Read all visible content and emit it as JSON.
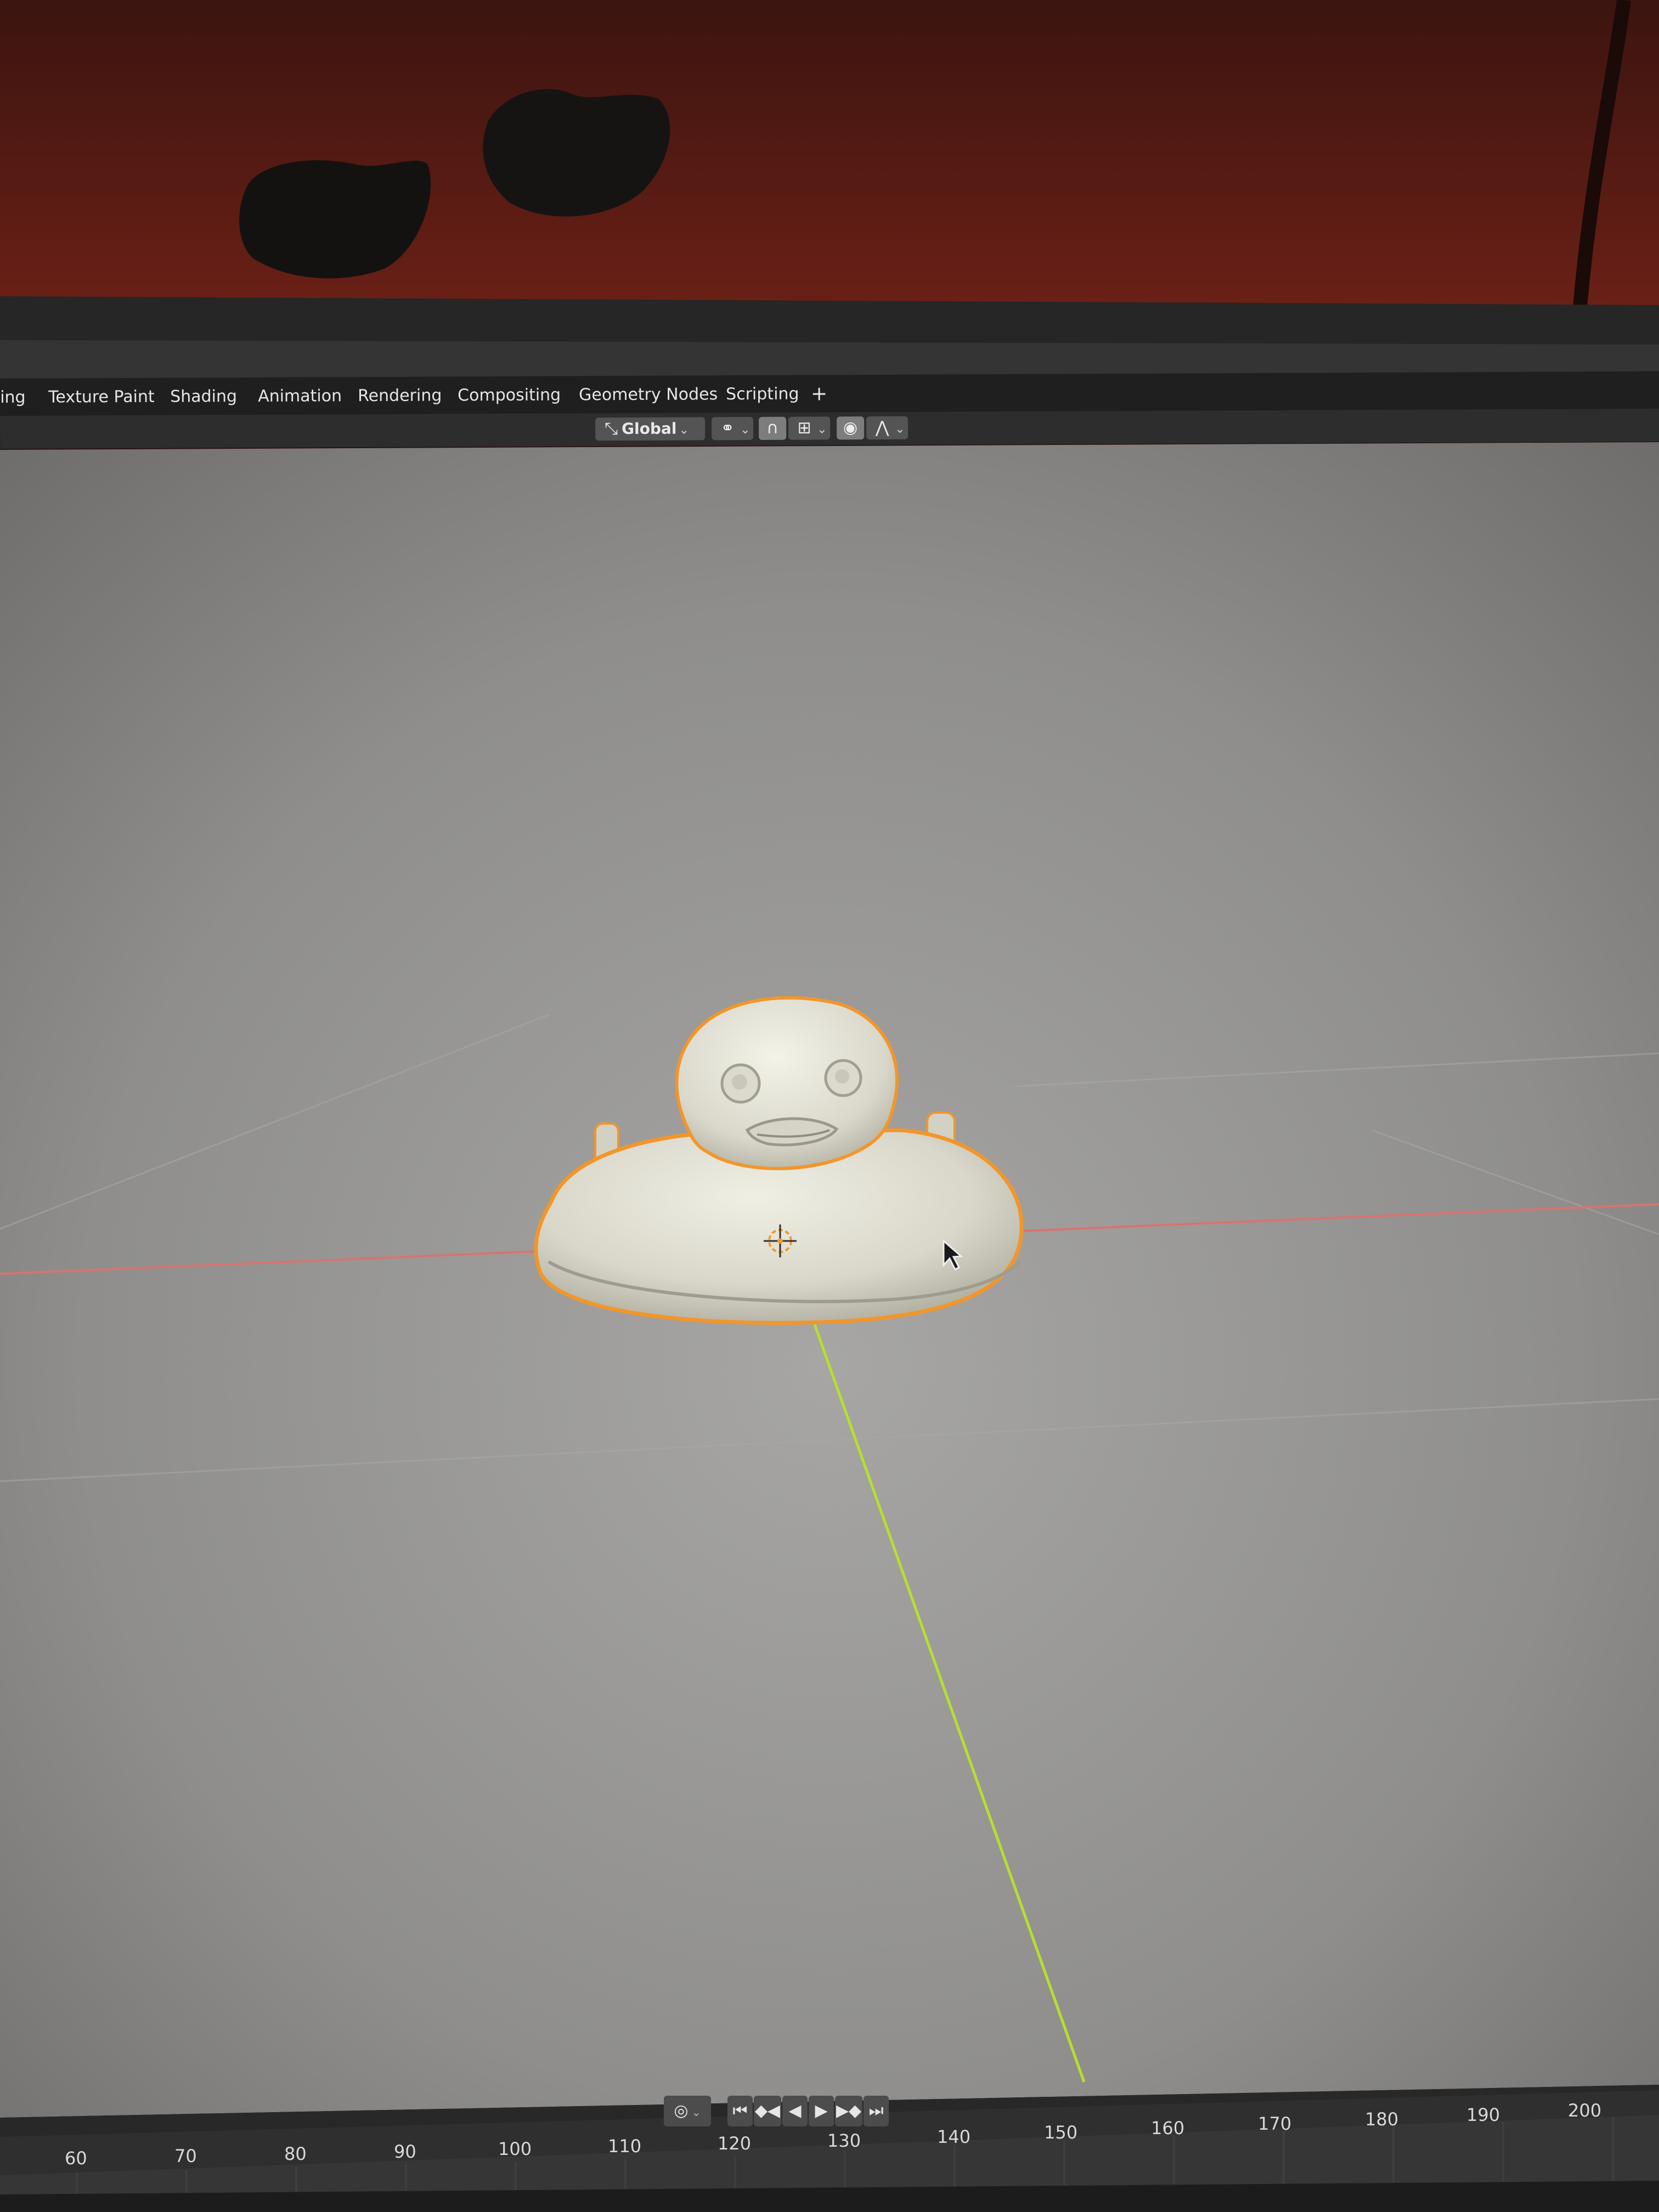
{
  "workspace_tabs": [
    {
      "label": "ing"
    },
    {
      "label": "Texture Paint"
    },
    {
      "label": "Shading"
    },
    {
      "label": "Animation"
    },
    {
      "label": "Rendering"
    },
    {
      "label": "Compositing"
    },
    {
      "label": "Geometry Nodes"
    },
    {
      "label": "Scripting"
    }
  ],
  "add_workspace_label": "+",
  "viewport_header": {
    "transform_orientation": "Global",
    "orientation_icon": "transform-orientation-icon",
    "pivot_icon": "pivot-point-icon",
    "snap_icon": "snap-magnet-icon",
    "snap_target_icon": "snap-increment-icon",
    "proportional_icon": "proportional-editing-icon",
    "falloff_icon": "falloff-curve-icon"
  },
  "playback": {
    "record_icon": "record-icon",
    "controls": [
      "jump-start-icon",
      "jump-keyframe-back-icon",
      "play-reverse-icon",
      "play-icon",
      "jump-keyframe-forward-icon",
      "jump-end-icon"
    ]
  },
  "timeline": {
    "frames": [
      "60",
      "70",
      "80",
      "90",
      "100",
      "110",
      "120",
      "130",
      "140",
      "150",
      "160",
      "170",
      "180",
      "190",
      "200"
    ]
  },
  "colors": {
    "selection_outline": "#f2962a",
    "x_axis": "#d9736f",
    "y_axis": "#b6df2f",
    "object_origin": "#f09a30",
    "viewport_bg": "#8c8c8b"
  }
}
